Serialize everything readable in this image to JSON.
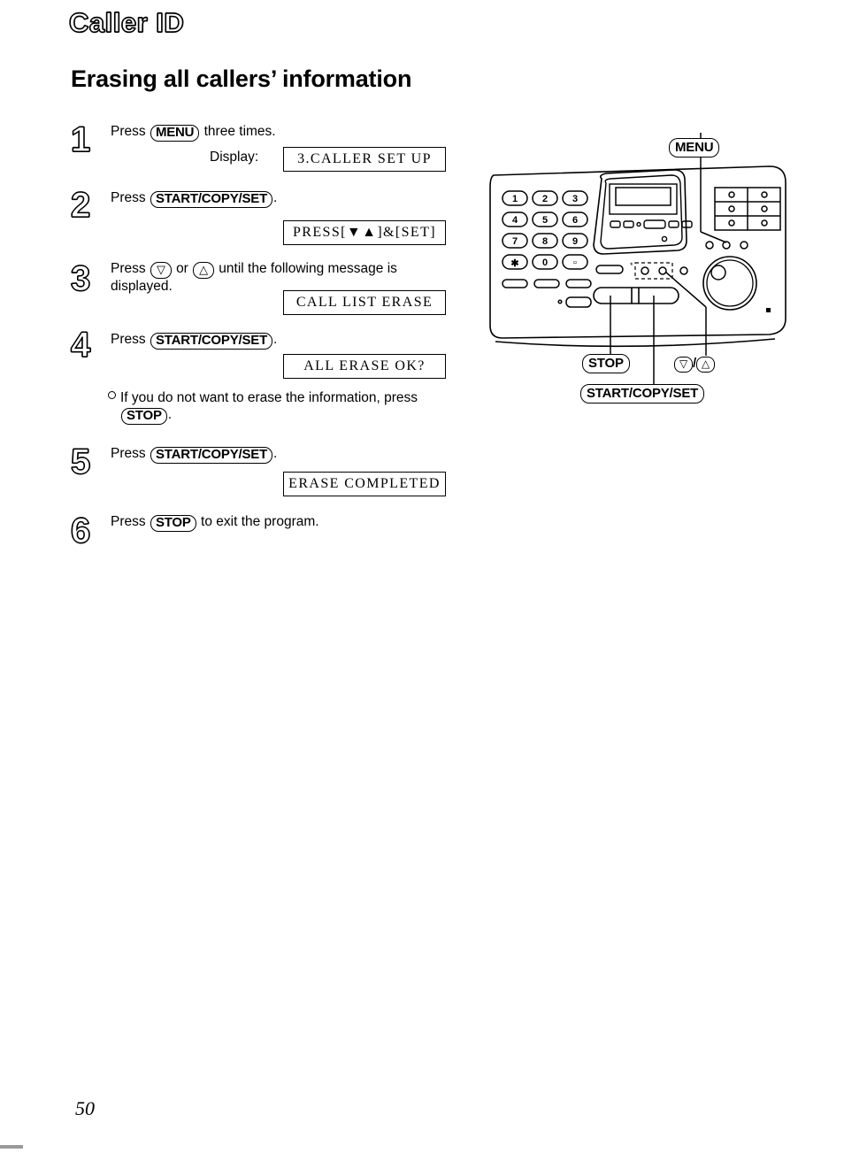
{
  "document": {
    "chapter_title": "Caller ID",
    "section_title": "Erasing all callers’ information",
    "page_number": "50"
  },
  "steps": [
    {
      "number": "1",
      "text_before": "Press",
      "key": "MENU",
      "text_after": "three times.",
      "display_label": "Display:",
      "display_text": "3.CALLER SET UP"
    },
    {
      "number": "2",
      "text_before": "Press",
      "key": "START/COPY/SET",
      "text_after": ".",
      "display_text": "PRESS[▼▲]&[SET]"
    },
    {
      "number": "3",
      "text_before": "Press",
      "key_down": "▽",
      "text_middle": "or",
      "key_up": "△",
      "text_after": "until the following message is displayed.",
      "display_text": "CALL LIST ERASE"
    },
    {
      "number": "4",
      "text_before": "Press",
      "key": "START/COPY/SET",
      "text_after": ".",
      "display_text": "ALL ERASE OK?"
    },
    {
      "number": "5",
      "text_before": "Press",
      "key": "START/COPY/SET",
      "text_after": ".",
      "display_text": "ERASE COMPLETED"
    },
    {
      "number": "6",
      "text_before": "Press",
      "key": "STOP",
      "text_after": "to exit the program."
    }
  ],
  "note": {
    "text_before": "If you do not want to erase the information, press",
    "key": "STOP",
    "text_after": "."
  },
  "figure": {
    "name": "fax-machine-control-panel",
    "callout_menu": "MENU",
    "callout_stop": "STOP",
    "callout_start": "START/COPY/SET",
    "callout_arrow_down": "▽",
    "callout_arrow_separator": "/",
    "callout_arrow_up": "△",
    "keypad": [
      [
        "1",
        "2",
        "3"
      ],
      [
        "4",
        "5",
        "6"
      ],
      [
        "7",
        "8",
        "9"
      ],
      [
        "✶",
        "0",
        "□"
      ]
    ]
  }
}
